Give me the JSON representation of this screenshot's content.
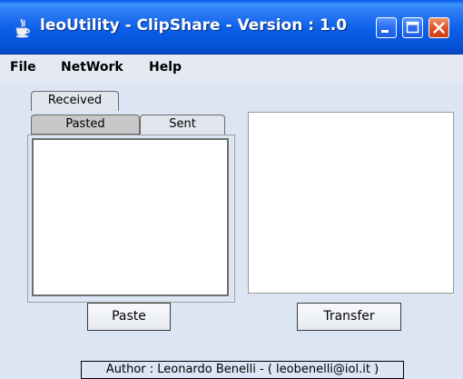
{
  "window": {
    "title": "leoUtility - ClipShare - Version : 1.0",
    "icon": "java-cup-icon",
    "controls": [
      "minimize-icon",
      "maximize-icon",
      "close-icon"
    ]
  },
  "menu": {
    "file": "File",
    "network": "NetWork",
    "help": "Help"
  },
  "tabs": {
    "received": "Received",
    "pasted": "Pasted",
    "sent": "Sent",
    "selected": "Pasted"
  },
  "pasted_text": {
    "value": ""
  },
  "transfer_text": {
    "value": ""
  },
  "buttons": {
    "paste": "Paste",
    "transfer": "Transfer"
  },
  "footer": {
    "author": "Author : Leonardo Benelli - ( leobenelli@iol.it )"
  },
  "colors": {
    "titlebar": "#0a5fe8",
    "close_button": "#e0532a",
    "content_bg": "#dbe5f3",
    "menubar_bg": "#e4e9f2"
  }
}
